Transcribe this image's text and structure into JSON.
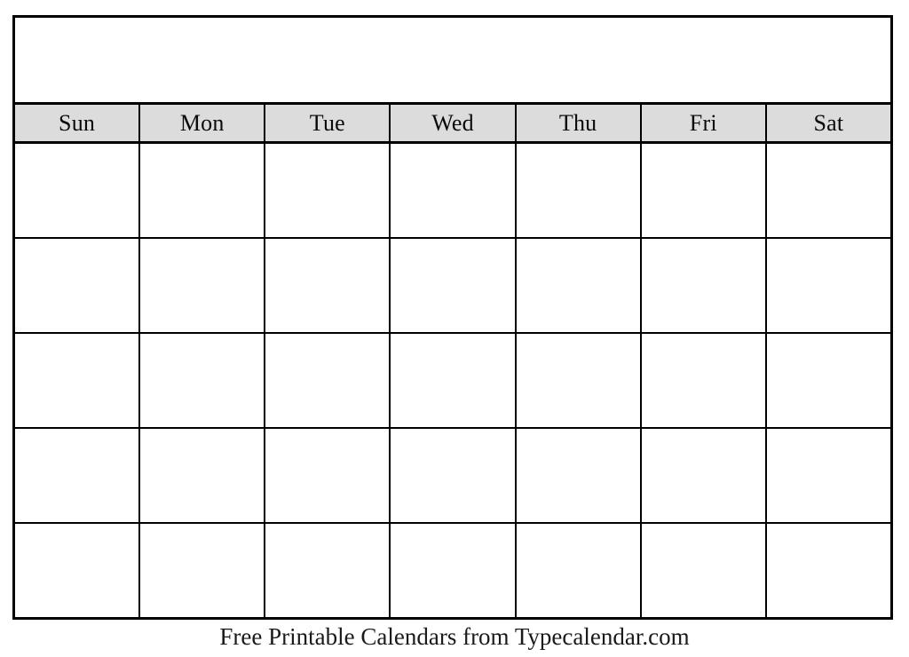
{
  "page": {
    "background_color": "#ffffff",
    "document_type": "blank printable monthly calendar"
  },
  "calendar": {
    "title": "",
    "border_color": "#000000",
    "header_background_color": "#dcdcdc",
    "cell_background_color": "#ffffff",
    "weekday_headers": [
      {
        "label": "Sun"
      },
      {
        "label": "Mon"
      },
      {
        "label": "Tue"
      },
      {
        "label": "Wed"
      },
      {
        "label": "Thu"
      },
      {
        "label": "Fri"
      },
      {
        "label": "Sat"
      }
    ],
    "weeks": [
      {
        "days": [
          {
            "number": ""
          },
          {
            "number": ""
          },
          {
            "number": ""
          },
          {
            "number": ""
          },
          {
            "number": ""
          },
          {
            "number": ""
          },
          {
            "number": ""
          }
        ]
      },
      {
        "days": [
          {
            "number": ""
          },
          {
            "number": ""
          },
          {
            "number": ""
          },
          {
            "number": ""
          },
          {
            "number": ""
          },
          {
            "number": ""
          },
          {
            "number": ""
          }
        ]
      },
      {
        "days": [
          {
            "number": ""
          },
          {
            "number": ""
          },
          {
            "number": ""
          },
          {
            "number": ""
          },
          {
            "number": ""
          },
          {
            "number": ""
          },
          {
            "number": ""
          }
        ]
      },
      {
        "days": [
          {
            "number": ""
          },
          {
            "number": ""
          },
          {
            "number": ""
          },
          {
            "number": ""
          },
          {
            "number": ""
          },
          {
            "number": ""
          },
          {
            "number": ""
          }
        ]
      },
      {
        "days": [
          {
            "number": ""
          },
          {
            "number": ""
          },
          {
            "number": ""
          },
          {
            "number": ""
          },
          {
            "number": ""
          },
          {
            "number": ""
          },
          {
            "number": ""
          }
        ]
      }
    ]
  },
  "footer": {
    "credit": "Free Printable Calendars from Typecalendar.com"
  }
}
